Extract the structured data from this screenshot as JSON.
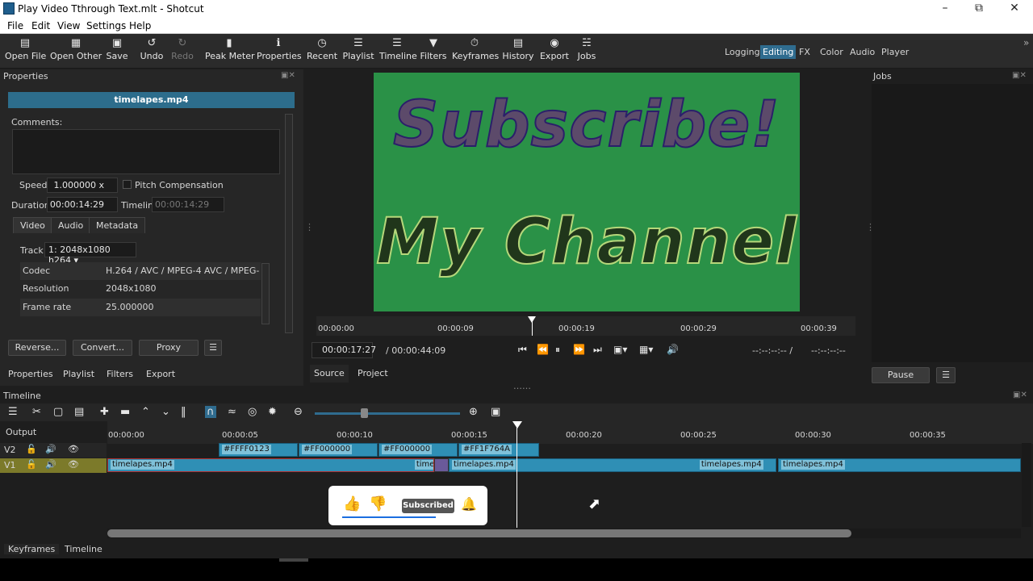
{
  "window": {
    "title": "Play Video Tthrough Text.mlt - Shotcut"
  },
  "menu": [
    "File",
    "Edit",
    "View",
    "Settings",
    "Help"
  ],
  "toolbar": {
    "items": [
      {
        "label": "Open File",
        "icon": "open-file-icon"
      },
      {
        "label": "Open Other",
        "icon": "open-other-icon"
      },
      {
        "label": "Save",
        "icon": "save-icon"
      },
      {
        "label": "Undo",
        "icon": "undo-icon"
      },
      {
        "label": "Redo",
        "icon": "redo-icon"
      },
      {
        "label": "Peak Meter",
        "icon": "peak-meter-icon"
      },
      {
        "label": "Properties",
        "icon": "info-icon"
      },
      {
        "label": "Recent",
        "icon": "clock-icon"
      },
      {
        "label": "Playlist",
        "icon": "list-icon"
      },
      {
        "label": "Timeline",
        "icon": "timeline-icon"
      },
      {
        "label": "Filters",
        "icon": "filter-icon"
      },
      {
        "label": "Keyframes",
        "icon": "stopwatch-icon"
      },
      {
        "label": "History",
        "icon": "history-icon"
      },
      {
        "label": "Export",
        "icon": "export-icon"
      },
      {
        "label": "Jobs",
        "icon": "jobs-icon"
      }
    ],
    "layouts": [
      "Logging",
      "Editing",
      "FX",
      "Color",
      "Audio",
      "Player"
    ],
    "active_layout": "Editing"
  },
  "properties": {
    "panel_title": "Properties",
    "file_name": "timelapes.mp4",
    "comments_label": "Comments:",
    "speed_label": "Speed",
    "speed_value": "1.000000 x",
    "pitch_label": "Pitch Compensation",
    "duration_label": "Duration",
    "duration_value": "00:00:14:29",
    "timeline_label": "Timeline",
    "timeline_value": "00:00:14:29",
    "tabs": [
      "Video",
      "Audio",
      "Metadata"
    ],
    "track_label": "Track",
    "track_value": "1: 2048x1080 h264",
    "rows": [
      {
        "key": "Codec",
        "value": "H.264 / AVC / MPEG-4 AVC / MPEG-..."
      },
      {
        "key": "Resolution",
        "value": "2048x1080"
      },
      {
        "key": "Frame rate",
        "value": "25.000000"
      }
    ],
    "buttons": [
      "Reverse...",
      "Convert...",
      "Proxy"
    ]
  },
  "left_tabs": [
    "Properties",
    "Playlist",
    "Filters",
    "Export"
  ],
  "viewer": {
    "text_line1": "Subscribe!",
    "text_line2": "My Channel",
    "ruler_ticks": [
      "00:00:00",
      "00:00:09",
      "00:00:19",
      "00:00:29",
      "00:00:39"
    ],
    "current_time": "00:00:17:27",
    "total_time": "/ 00:00:44:09",
    "in_point": "--:--:--:-- /",
    "out_point": "--:--:--:--",
    "tabs": [
      "Source",
      "Project"
    ],
    "playhead_fraction": 0.4
  },
  "jobs": {
    "panel_title": "Jobs",
    "pause_label": "Pause"
  },
  "timeline": {
    "panel_title": "Timeline",
    "output_label": "Output",
    "tracks": [
      "V2",
      "V1"
    ],
    "ruler_ticks": [
      "00:00:00",
      "00:00:05",
      "00:00:10",
      "00:00:15",
      "00:00:20",
      "00:00:25",
      "00:00:30",
      "00:00:35"
    ],
    "v2_clips": [
      "#FFFF0123",
      "#FF000000",
      "#FF000000",
      "#FF1F764A"
    ],
    "v1_clips": [
      "timelapes.mp4",
      "timelapes.mp4",
      "timelapes.mp4",
      "timelapes.mp4",
      "timelapes.mp4"
    ]
  },
  "overlay": {
    "subscribed_label": "Subscribed"
  },
  "bottom_tabs": [
    "Keyframes",
    "Timeline"
  ],
  "colors": {
    "accent": "#2f6c8f",
    "clip": "#2f8fb5",
    "video_bg": "#2a9147"
  }
}
